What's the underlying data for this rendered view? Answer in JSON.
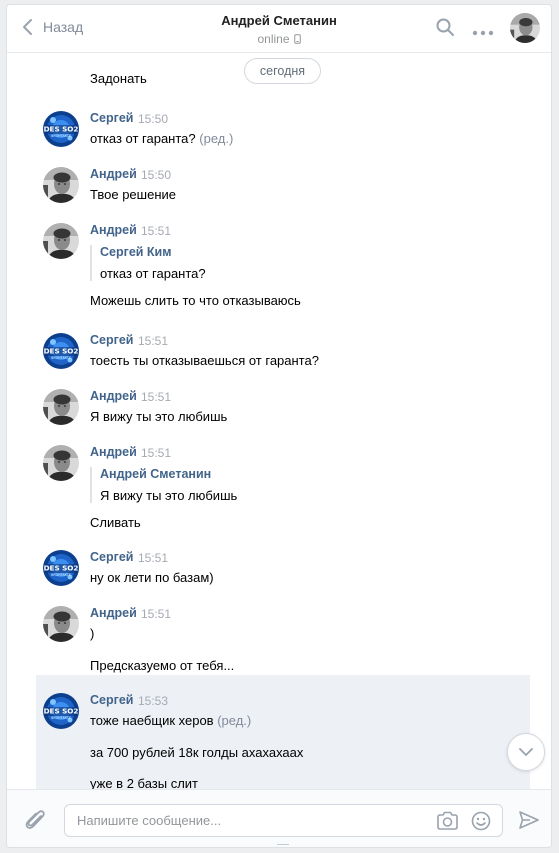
{
  "header": {
    "back_label": "Назад",
    "title": "Андрей Сметанин",
    "status": "online"
  },
  "date_divider": "сегодня",
  "top_cut_message": "Задонать",
  "messages": [
    {
      "author": "Сергей",
      "time": "15:50",
      "avatar": "sergey",
      "lines": [
        "отказ от гаранта?"
      ],
      "edited": "(ред.)"
    },
    {
      "author": "Андрей",
      "time": "15:50",
      "avatar": "andrey",
      "lines": [
        "Твое решение"
      ]
    },
    {
      "author": "Андрей",
      "time": "15:51",
      "avatar": "andrey",
      "quote": {
        "name": "Сергей Ким",
        "text": "отказ от гаранта?"
      },
      "lines": [
        "Можешь слить то что отказываюсь"
      ]
    },
    {
      "author": "Сергей",
      "time": "15:51",
      "avatar": "sergey",
      "lines": [
        "тоесть ты отказываешься от гаранта?"
      ]
    },
    {
      "author": "Андрей",
      "time": "15:51",
      "avatar": "andrey",
      "lines": [
        "Я вижу ты это любишь"
      ]
    },
    {
      "author": "Андрей",
      "time": "15:51",
      "avatar": "andrey",
      "quote": {
        "name": "Андрей Сметанин",
        "text": "Я вижу ты это любишь"
      },
      "lines": [
        "Сливать"
      ]
    },
    {
      "author": "Сергей",
      "time": "15:51",
      "avatar": "sergey",
      "lines": [
        "ну ок лети по базам)"
      ]
    },
    {
      "author": "Андрей",
      "time": "15:51",
      "avatar": "andrey",
      "lines": [
        ")",
        "Предсказуемо от тебя..."
      ]
    },
    {
      "author": "Сергей",
      "time": "15:53",
      "avatar": "sergey",
      "lines": [
        "тоже наебщик херов",
        "за 700 рублей 18к голды ахахахаах",
        "уже в 2 базы слит"
      ],
      "edited": "(ред.)",
      "highlighted": true
    }
  ],
  "avatar_badge": {
    "line1": "DES SO2",
    "line2": "ВКОНТАКТЕ"
  },
  "composer": {
    "placeholder": "Напишите сообщение..."
  },
  "colors": {
    "link": "#42648b",
    "muted": "#828a99",
    "highlight": "#edf0f5",
    "background": "#edeef0"
  }
}
